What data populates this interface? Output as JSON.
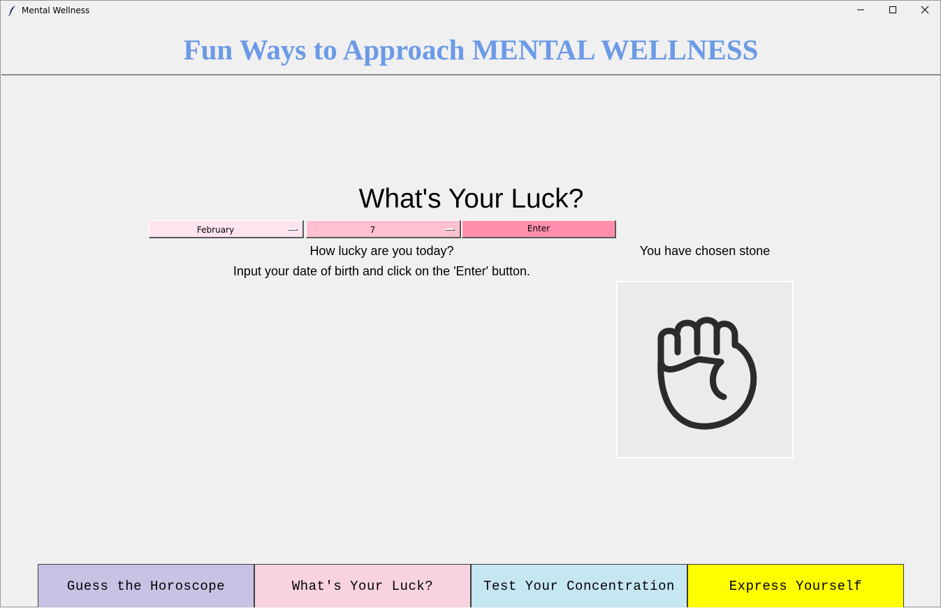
{
  "window": {
    "title": "Mental Wellness",
    "icon": "feather-icon",
    "controls": [
      "minimize-icon",
      "maximize-icon",
      "close-icon"
    ]
  },
  "header": {
    "title": "Fun Ways to Approach MENTAL WELLNESS",
    "title_color": "#6b9ae6"
  },
  "luck": {
    "title": "What's Your Luck?",
    "month_select": {
      "value": "February",
      "color": "#ffe4f0"
    },
    "day_select": {
      "value": "7",
      "color": "#ffc0cf"
    },
    "enter_label": "Enter",
    "enter_color": "#ff8fac",
    "prompt_line1": "How lucky are you today?",
    "prompt_line2": "Input your date of birth and click on the 'Enter' button.",
    "chosen_text": "You have chosen stone",
    "chosen_icon": "fist-icon"
  },
  "nav": {
    "items": [
      {
        "label": "Guess the Horoscope",
        "color": "#c9c2e4"
      },
      {
        "label": "What's Your Luck?",
        "color": "#f6d3df"
      },
      {
        "label": "Test Your Concentration",
        "color": "#c6e6f2"
      },
      {
        "label": "Express Yourself",
        "color": "#ffff00"
      }
    ]
  }
}
